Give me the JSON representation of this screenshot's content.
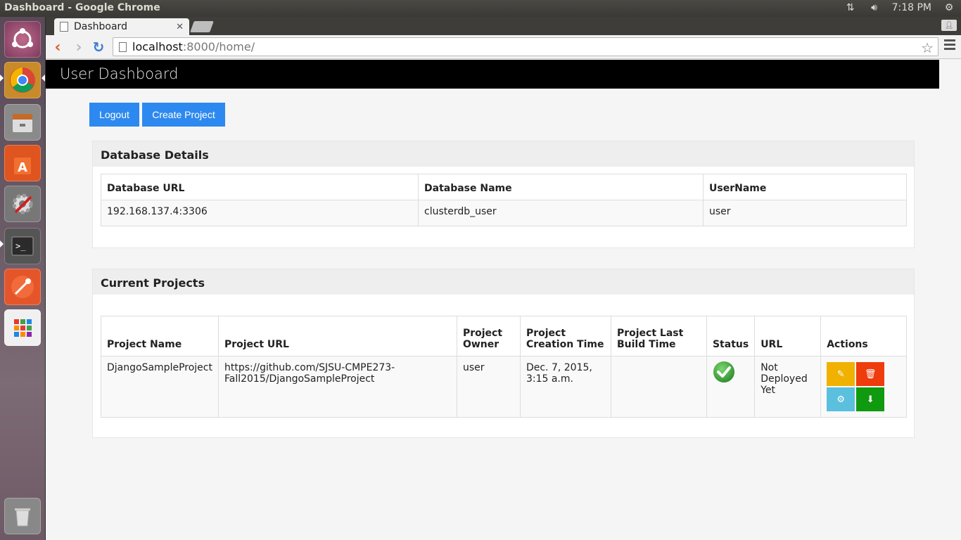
{
  "os": {
    "window_title": "Dashboard - Google Chrome",
    "clock": "7:18 PM"
  },
  "browser": {
    "tab_title": "Dashboard",
    "url_host": "localhost",
    "url_path": ":8000/home/"
  },
  "app": {
    "header_title": "User Dashboard",
    "logout_label": "Logout",
    "create_project_label": "Create Project"
  },
  "database": {
    "heading": "Database Details",
    "columns": [
      "Database URL",
      "Database Name",
      "UserName"
    ],
    "row": [
      "192.168.137.4:3306",
      "clusterdb_user",
      "user"
    ]
  },
  "projects": {
    "heading": "Current Projects",
    "columns": {
      "name": "Project Name",
      "url": "Project URL",
      "owner_l1": "Project",
      "owner_l2": "Owner",
      "created_l1": "Project",
      "created_l2": "Creation Time",
      "build_l1": "Project Last",
      "build_l2": "Build Time",
      "status": "Status",
      "deploy_url": "URL",
      "actions": "Actions"
    },
    "rows": [
      {
        "name": "DjangoSampleProject",
        "url_l1": "https://github.com/SJSU-CMPE273-",
        "url_l2": "Fall2015/DjangoSampleProject",
        "owner": "user",
        "created_l1": "Dec. 7, 2015,",
        "created_l2": "3:15 a.m.",
        "build": "",
        "deploy_l1": "Not",
        "deploy_l2": "Deployed",
        "deploy_l3": "Yet"
      }
    ]
  },
  "colors": {
    "primary_button": "#2d89ef",
    "edit": "#f0b100",
    "delete": "#ef3c0c",
    "settings": "#5bc0de",
    "download": "#109a10",
    "status_ok": "#3aa53a"
  },
  "icons": {
    "status": "check-circle-icon",
    "edit": "edit-icon",
    "delete": "trash-icon",
    "settings": "gear-icon",
    "download": "download-icon"
  }
}
